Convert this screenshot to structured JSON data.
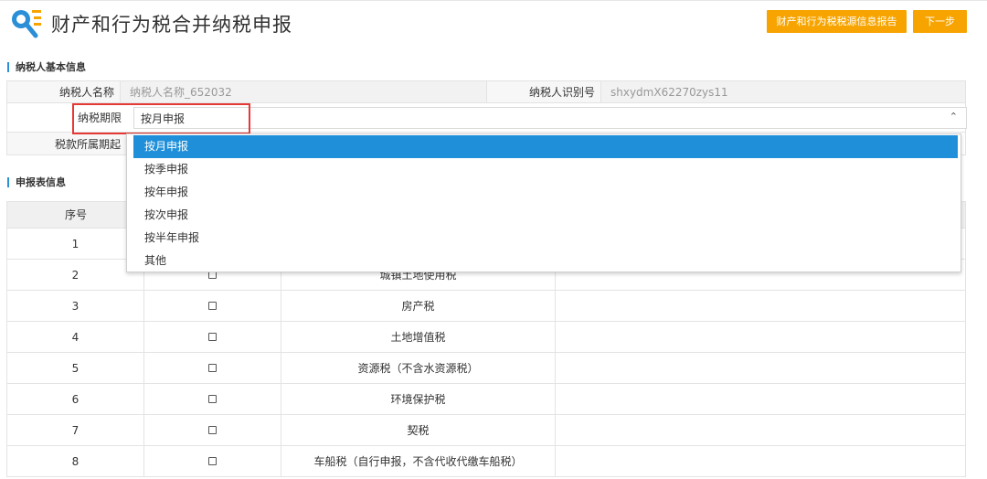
{
  "header": {
    "title": "财产和行为税合并纳税申报",
    "report_button": "财产和行为税税源信息报告",
    "next_button": "下一步",
    "logo_icon": "magnifier-list-icon"
  },
  "basic_info": {
    "section_title": "纳税人基本信息",
    "taxpayer_name_label": "纳税人名称",
    "taxpayer_name_value": "纳税人名称_652032",
    "taxpayer_id_label": "纳税人识别号",
    "taxpayer_id_value": "shxydmX62270zys11",
    "period_label": "纳税期限",
    "period_selected": "按月申报",
    "tax_period_start_label": "税款所属期起"
  },
  "dropdown": {
    "options": [
      "按月申报",
      "按季申报",
      "按年申报",
      "按次申报",
      "按半年申报",
      "其他"
    ],
    "selected_index": 0
  },
  "declaration": {
    "section_title": "申报表信息",
    "header_no": "序号",
    "rows": [
      {
        "no": "1",
        "name": ""
      },
      {
        "no": "2",
        "name": "城镇土地使用税"
      },
      {
        "no": "3",
        "name": "房产税"
      },
      {
        "no": "4",
        "name": "土地增值税"
      },
      {
        "no": "5",
        "name": "资源税（不含水资源税）"
      },
      {
        "no": "6",
        "name": "环境保护税"
      },
      {
        "no": "7",
        "name": "契税"
      },
      {
        "no": "8",
        "name": "车船税（自行申报，不含代收代缴车船税）"
      }
    ]
  },
  "colors": {
    "accent_orange": "#f7a400",
    "selected_blue": "#1e8fd8",
    "highlight_red": "#e53935"
  }
}
